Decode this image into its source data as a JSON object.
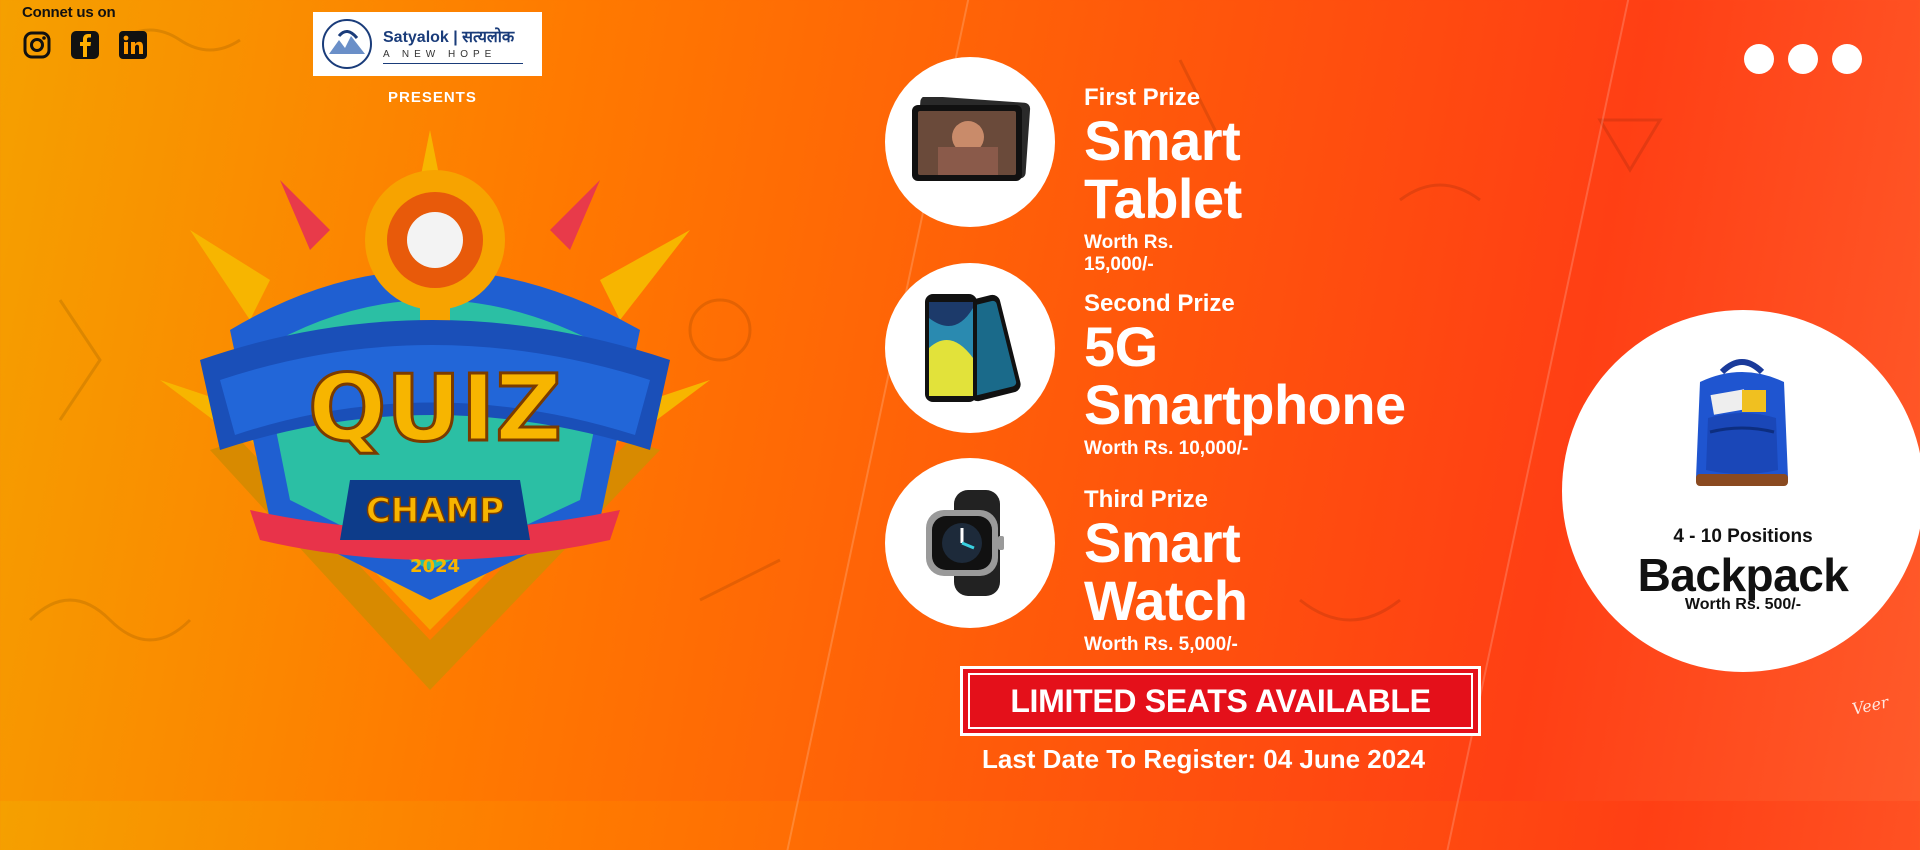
{
  "connect": {
    "label": "Connet us on",
    "icons": [
      "instagram-icon",
      "facebook-icon",
      "linkedin-icon"
    ]
  },
  "logo": {
    "name": "Satyalok | सत्यलोक",
    "tagline": "A NEW HOPE"
  },
  "presents": "PRESENTS",
  "badge": {
    "title": "QUIZ",
    "subtitle": "CHAMP",
    "year": "2024"
  },
  "prizes": [
    {
      "rank": "First Prize",
      "name": "Smart Tablet",
      "worth": "Worth Rs. 15,000/-",
      "icon": "tablet-icon"
    },
    {
      "rank": "Second Prize",
      "name": "5G Smartphone",
      "worth": "Worth Rs. 10,000/-",
      "icon": "smartphone-icon"
    },
    {
      "rank": "Third Prize",
      "name": "Smart Watch",
      "worth": "Worth Rs. 5,000/-",
      "icon": "smartwatch-icon"
    }
  ],
  "extra_prize": {
    "positions": "4 - 10 Positions",
    "name": "Backpack",
    "worth": "Worth Rs. 500/-",
    "icon": "backpack-icon"
  },
  "cta": {
    "label": "LIMITED SEATS AVAILABLE"
  },
  "last_date": "Last Date To Register: 04 June 2024",
  "signature": "Veer",
  "colors": {
    "cta_red": "#e4101a",
    "bg_orange": "#ff6a00",
    "badge_blue": "#1f5fd1"
  }
}
